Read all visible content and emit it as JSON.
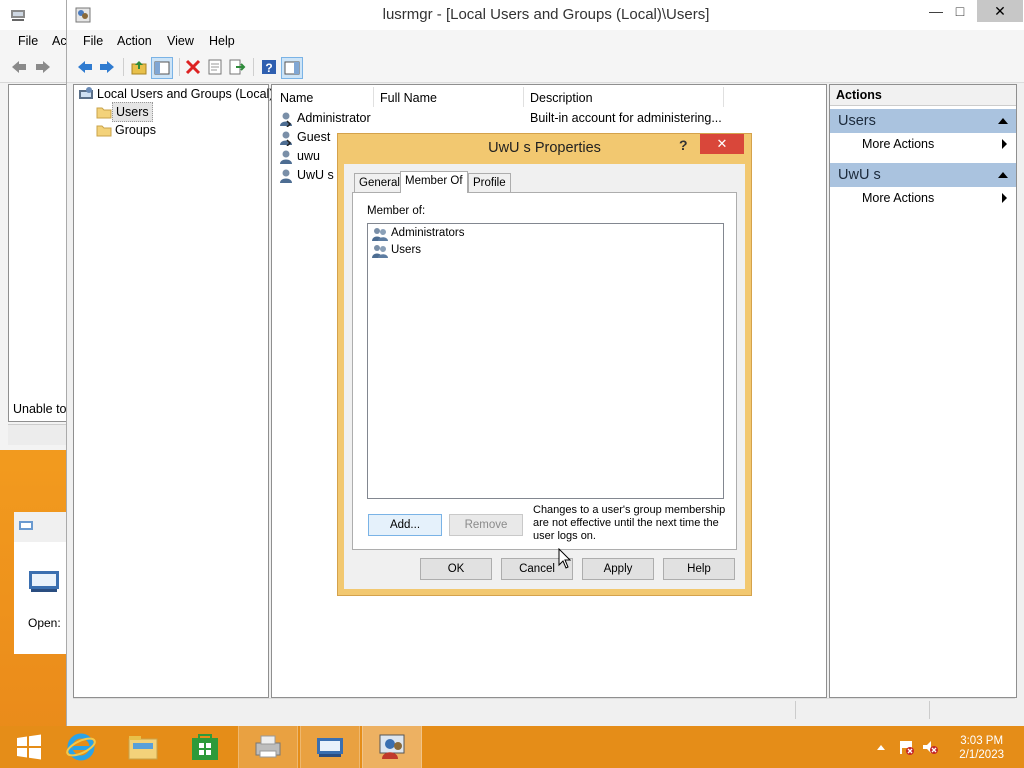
{
  "colors": {
    "accent": "#f29a1e",
    "action_header": "#aac3df",
    "dialog_frame": "#f2c870",
    "close_red": "#d9473a"
  },
  "back_window": {
    "menu": [
      "File",
      "Ac"
    ],
    "status": "Unable to",
    "dialog_label": "Open:"
  },
  "window": {
    "title": "lusrmgr - [Local Users and Groups (Local)\\Users]",
    "menu": [
      "File",
      "Action",
      "View",
      "Help"
    ],
    "toolbar_icons": [
      "back-icon",
      "forward-icon",
      "up-folder-icon",
      "show-hide-tree-icon",
      "delete-icon",
      "properties-icon",
      "export-icon",
      "help-icon",
      "show-hide-action-pane-icon"
    ]
  },
  "tree": {
    "root": "Local Users and Groups (Local)",
    "children": [
      "Users",
      "Groups"
    ],
    "selected": "Users"
  },
  "list": {
    "columns": [
      "Name",
      "Full Name",
      "Description"
    ],
    "rows": [
      {
        "name": "Administrator",
        "full_name": "",
        "description": "Built-in account for administering..."
      },
      {
        "name": "Guest",
        "full_name": "",
        "description": ""
      },
      {
        "name": "uwu",
        "full_name": "",
        "description": ""
      },
      {
        "name": "UwU s",
        "full_name": "",
        "description": ""
      }
    ]
  },
  "actions": {
    "header": "Actions",
    "sections": [
      {
        "title": "Users",
        "items": [
          "More Actions"
        ]
      },
      {
        "title": "UwU s",
        "items": [
          "More Actions"
        ]
      }
    ]
  },
  "dialog": {
    "title": "UwU s Properties",
    "help": "?",
    "close": "✕",
    "tabs": [
      "General",
      "Member Of",
      "Profile"
    ],
    "active_tab": "Member Of",
    "member_of_label": "Member of:",
    "groups": [
      "Administrators",
      "Users"
    ],
    "add_button": "Add...",
    "remove_button": "Remove",
    "note": "Changes to a user's group membership are not effective until the next time the user logs on.",
    "buttons": [
      "OK",
      "Cancel",
      "Apply",
      "Help"
    ]
  },
  "taskbar": {
    "apps": [
      "start-icon",
      "internet-explorer-icon",
      "file-explorer-icon",
      "store-icon",
      "printer-app-icon",
      "remote-app-icon",
      "lusrmgr-icon"
    ],
    "time": "3:03 PM",
    "date": "2/1/2023"
  }
}
